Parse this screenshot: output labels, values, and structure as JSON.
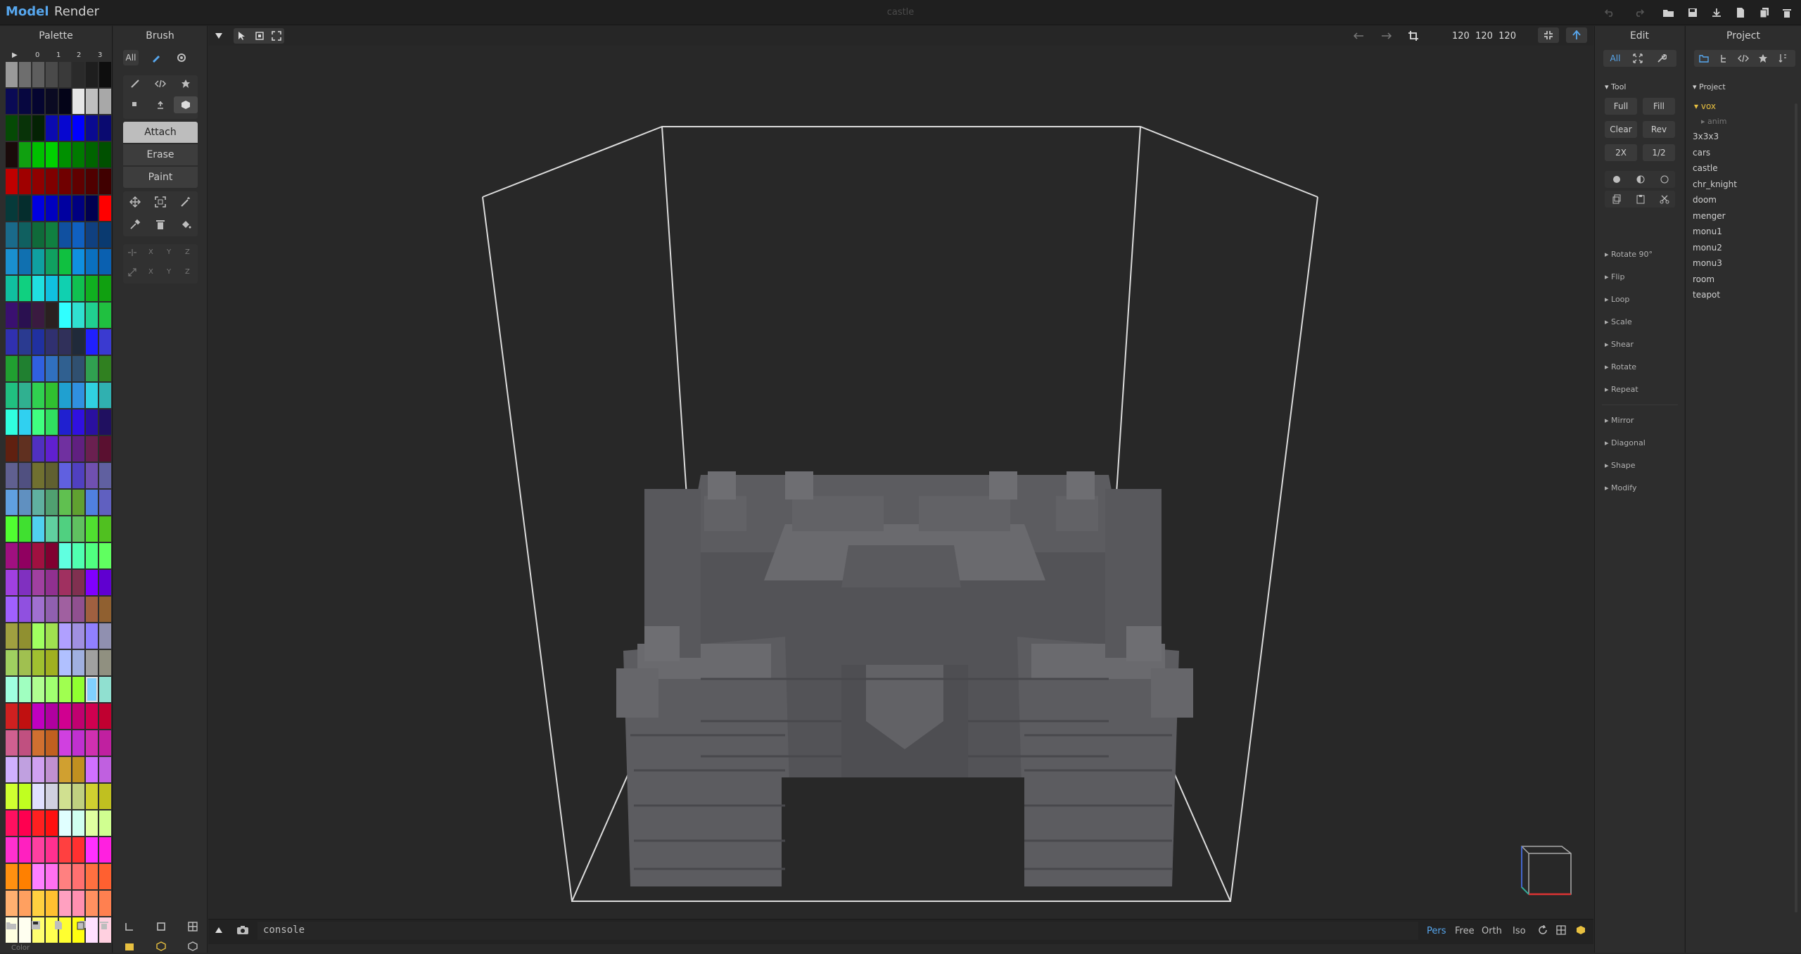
{
  "app": {
    "title": "castle",
    "modes": [
      "Model",
      "Render"
    ],
    "active_mode": "Model"
  },
  "palette": {
    "title": "Palette",
    "row_header": [
      "▶",
      "0",
      "1",
      "2",
      "3"
    ],
    "colors": [
      "#9a9a9a",
      "#6e6e6e",
      "#5e5e5e",
      "#4a4a4a",
      "#3a3a3a",
      "#2a2a2a",
      "#1e1e1e",
      "#0e0e0e",
      "#0a0a55",
      "#070740",
      "#050530",
      "#0a0a22",
      "#040418",
      "#e6e6e6",
      "#bfbfbf",
      "#a8a8a8",
      "#054a05",
      "#083308",
      "#042204",
      "#0a0ab0",
      "#0707d0",
      "#0000ff",
      "#0a0a90",
      "#0a0a70",
      "#1a0a0a",
      "#10a010",
      "#00c000",
      "#00d000",
      "#009000",
      "#007a00",
      "#006400",
      "#005000",
      "#c00000",
      "#a00000",
      "#900000",
      "#800000",
      "#700000",
      "#600000",
      "#500000",
      "#400000",
      "#063a3a",
      "#052d2d",
      "#0000e0",
      "#0000c0",
      "#0000a0",
      "#000080",
      "#000050",
      "#ff0000",
      "#1a6a8a",
      "#106060",
      "#106a3a",
      "#108040",
      "#1050a0",
      "#1060c0",
      "#104080",
      "#0a3a70",
      "#1a90d0",
      "#1070b0",
      "#10a0a0",
      "#10a060",
      "#10c040",
      "#1090e0",
      "#0a70c0",
      "#0a60b0",
      "#10c0a0",
      "#10d080",
      "#20e0e0",
      "#10c0e0",
      "#10d0b0",
      "#10c050",
      "#10b020",
      "#10a010",
      "#3a1070",
      "#2a1050",
      "#3a1a40",
      "#2a2020",
      "#30ffff",
      "#30e0d0",
      "#20d090",
      "#20c040",
      "#3030b0",
      "#2a3a90",
      "#2030a0",
      "#303070",
      "#30305a",
      "#202a3a",
      "#2020ff",
      "#3a3ad0",
      "#20a030",
      "#208030",
      "#3060e0",
      "#3070c0",
      "#306090",
      "#305070",
      "#30a050",
      "#308020",
      "#20c080",
      "#30b090",
      "#30d050",
      "#30c030",
      "#20a0d0",
      "#3090e0",
      "#30d0e0",
      "#30b0b0",
      "#30ffe0",
      "#30d0f0",
      "#40ff80",
      "#30e060",
      "#2020d0",
      "#3010e0",
      "#2a10a0",
      "#201060",
      "#602010",
      "#603020",
      "#5030c0",
      "#6020d0",
      "#7030a0",
      "#602080",
      "#6a2050",
      "#5a1030",
      "#606090",
      "#505080",
      "#707030",
      "#606030",
      "#6060e0",
      "#5040c0",
      "#7050b0",
      "#6060a0",
      "#60a0e0",
      "#6090c0",
      "#60b0a0",
      "#50a070",
      "#60c050",
      "#60a030",
      "#5080e0",
      "#6060c0",
      "#50ff30",
      "#40e030",
      "#50d0f0",
      "#60d0a0",
      "#50d080",
      "#60c060",
      "#50e030",
      "#50c020",
      "#a01080",
      "#900060",
      "#a01040",
      "#800030",
      "#60ffe0",
      "#50ffb0",
      "#50ff80",
      "#60ff60",
      "#a040e0",
      "#8030c0",
      "#a040a0",
      "#903090",
      "#a03060",
      "#803050",
      "#8000ff",
      "#6000d0",
      "#a060ff",
      "#9050e0",
      "#a070d0",
      "#9060b0",
      "#a060a0",
      "#905090",
      "#a06040",
      "#906030",
      "#a0a040",
      "#909030",
      "#a0ff60",
      "#a0e050",
      "#b0a0ff",
      "#a090e0",
      "#9080ff",
      "#9090b0",
      "#a0d060",
      "#a0c050",
      "#a0c030",
      "#a0b020",
      "#b0c0ff",
      "#a0b0e0",
      "#a0a0a0",
      "#909080",
      "#a0ffe0",
      "#a0ffc0",
      "#b0ff90",
      "#a0ff70",
      "#a0ff50",
      "#90ff30",
      "#80d0ff",
      "#90e0d0",
      "#d02020",
      "#c01010",
      "#c000c0",
      "#b000a0",
      "#d00090",
      "#c00070",
      "#d00050",
      "#c00030",
      "#d06090",
      "#c05080",
      "#d07030",
      "#c06020",
      "#d040e0",
      "#c030d0",
      "#d030b0",
      "#c020a0",
      "#d0b0ff",
      "#c0a0e0",
      "#d0a0f0",
      "#c090d0",
      "#d0a030",
      "#c09020",
      "#d070ff",
      "#c060e0",
      "#d0ff30",
      "#c0ff20",
      "#e0e0ff",
      "#d0d0e0",
      "#d0e090",
      "#c0d080",
      "#d0d030",
      "#c0c020",
      "#ff1060",
      "#ff0050",
      "#ff2020",
      "#ff1010",
      "#e0ffff",
      "#d0fff0",
      "#e0ffa0",
      "#d0ff90",
      "#ff30d0",
      "#ff20c0",
      "#ff40a0",
      "#ff3090",
      "#ff4040",
      "#ff3030",
      "#ff30ff",
      "#ff20e0",
      "#ff9010",
      "#ff8000",
      "#ff80ff",
      "#ff70f0",
      "#ff8080",
      "#ff7070",
      "#ff7040",
      "#ff6030",
      "#ffb070",
      "#ffa060",
      "#ffd040",
      "#ffc030",
      "#ffa0c0",
      "#ff90b0",
      "#ff9060",
      "#ff8050",
      "#ffffe0",
      "#fffff0",
      "#ffff70",
      "#ffff50",
      "#ffff30",
      "#ffff10",
      "#ffe0ff",
      "#ffd0e0"
    ],
    "bottom_label": "Color"
  },
  "brush": {
    "title": "Brush",
    "filter_all": "All",
    "modes": [
      "Attach",
      "Erase",
      "Paint"
    ],
    "active_mode": "Attach",
    "axes": [
      "X",
      "Y",
      "Z"
    ]
  },
  "viewport": {
    "dims": "120  120  120",
    "console_placeholder": "console",
    "views": [
      "Pers",
      "Free",
      "Orth",
      "Iso"
    ],
    "active_view": "Pers"
  },
  "edit": {
    "title": "Edit",
    "filter_all": "All",
    "tool_label": "Tool",
    "buttons": [
      [
        "Full",
        "Fill"
      ],
      [
        "Clear",
        "Rev"
      ],
      [
        "2X",
        "1/2"
      ]
    ],
    "sections": [
      "Rotate 90°",
      "Flip",
      "Loop",
      "Scale",
      "Shear",
      "Rotate",
      "Repeat",
      "Mirror",
      "Diagonal",
      "Shape",
      "Modify"
    ]
  },
  "project": {
    "title": "Project",
    "root_label": "Project",
    "folder": "vox",
    "subfolder": "anim",
    "items": [
      "3x3x3",
      "cars",
      "castle",
      "chr_knight",
      "doom",
      "menger",
      "monu1",
      "monu2",
      "monu3",
      "room",
      "teapot"
    ]
  },
  "colors": {
    "accent": "#57a7ee",
    "folder": "#e8c040",
    "bg": "#282828"
  }
}
